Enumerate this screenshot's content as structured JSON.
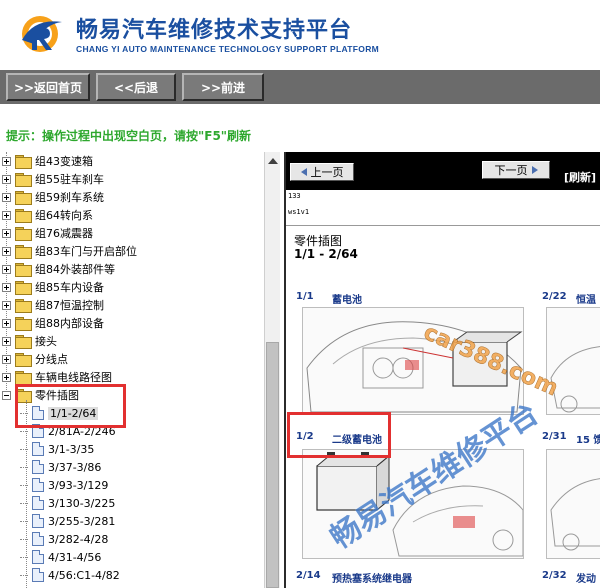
{
  "header": {
    "title": "畅易汽车维修技术支持平台",
    "subtitle": "CHANG YI AUTO MAINTENANCE TECHNOLOGY SUPPORT PLATFORM"
  },
  "nav": {
    "home": ">>返回首页",
    "back": "<<后退",
    "forward": ">>前进"
  },
  "notice": "提示：操作过程中出现空白页，请按\"F5\"刷新",
  "tree": {
    "items": [
      {
        "label": "组43变速箱"
      },
      {
        "label": "组55驻车刹车"
      },
      {
        "label": "组59刹车系统"
      },
      {
        "label": "组64转向系"
      },
      {
        "label": "组76减震器"
      },
      {
        "label": "组83车门与开启部位"
      },
      {
        "label": "组84外装部件等"
      },
      {
        "label": "组85车内设备"
      },
      {
        "label": "组87恒温控制"
      },
      {
        "label": "组88内部设备"
      },
      {
        "label": "接头"
      },
      {
        "label": "分线点"
      },
      {
        "label": "车辆电线路径图"
      },
      {
        "label": "零件插图"
      }
    ],
    "children": [
      {
        "label": "1/1-2/64"
      },
      {
        "label": "2/81A-2/246"
      },
      {
        "label": "3/1-3/35"
      },
      {
        "label": "3/37-3/86"
      },
      {
        "label": "3/93-3/129"
      },
      {
        "label": "3/130-3/225"
      },
      {
        "label": "3/255-3/281"
      },
      {
        "label": "3/282-4/28"
      },
      {
        "label": "4/31-4/56"
      },
      {
        "label": "4/56:C1-4/82"
      }
    ]
  },
  "viewer": {
    "prev": "上一页",
    "next": "下一页",
    "refresh": "[刷新]",
    "code1": "133",
    "code2": "ws1v1",
    "section_title": "零件插图",
    "section_range": "1/1 - 2/64",
    "entries": [
      {
        "num": "1/1",
        "label": "蓄电池"
      },
      {
        "num": "2/22",
        "label": "恒温"
      },
      {
        "num": "1/2",
        "label": "二级蓄电池"
      },
      {
        "num": "2/31",
        "label": "15 馈"
      },
      {
        "num": "2/14",
        "label": "预热塞系统继电器"
      },
      {
        "num": "2/32",
        "label": "发动"
      }
    ]
  },
  "watermarks": {
    "site": "car388.com",
    "brand": "畅易汽车维修平台"
  }
}
